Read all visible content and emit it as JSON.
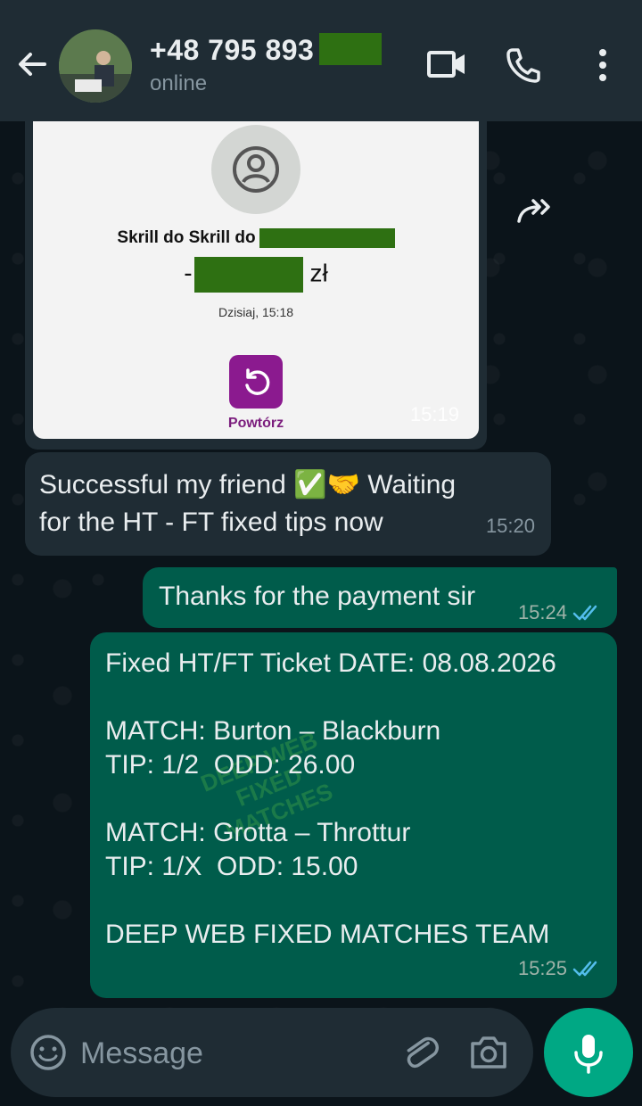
{
  "header": {
    "contact_number": "+48 795 893",
    "status": "online"
  },
  "image_message": {
    "transfer_line": "Skrill do Skrill do",
    "currency": "zł",
    "amount_prefix": "-",
    "date": "Dzisiaj, 15:18",
    "repeat_label": "Powtórz",
    "time": "15:19"
  },
  "messages": [
    {
      "direction": "incoming",
      "text_a": "Successful my friend",
      "text_b": "Waiting",
      "text_c": "for the HT - FT fixed tips now",
      "emojis": [
        "✅",
        "🤝"
      ],
      "time": "15:20"
    },
    {
      "direction": "outgoing",
      "text": "Thanks for the payment sir",
      "time": "15:24"
    },
    {
      "direction": "outgoing",
      "lines": [
        "Fixed HT/FT Ticket DATE: 08.08.2026",
        "MATCH: Burton – Blackburn",
        "TIP: 1/2  ODD: 26.00",
        "MATCH: Grotta – Throttur",
        "TIP: 1/X  ODD: 15.00",
        "DEEP WEB FIXED MATCHES TEAM"
      ],
      "watermark": "DEEP WEB FIXED MATCHES",
      "time": "15:25"
    }
  ],
  "composer": {
    "placeholder": "Message"
  },
  "colors": {
    "header_bg": "#1f2c34",
    "incoming_bubble": "#1f2c34",
    "outgoing_bubble": "#005c4b",
    "accent": "#00a884",
    "read_ticks": "#53bdeb",
    "redaction": "#2e7012"
  },
  "icons": [
    "back-arrow-icon",
    "video-call-icon",
    "phone-icon",
    "more-vert-icon",
    "forward-icon",
    "emoji-icon",
    "attach-icon",
    "camera-icon",
    "mic-icon"
  ]
}
